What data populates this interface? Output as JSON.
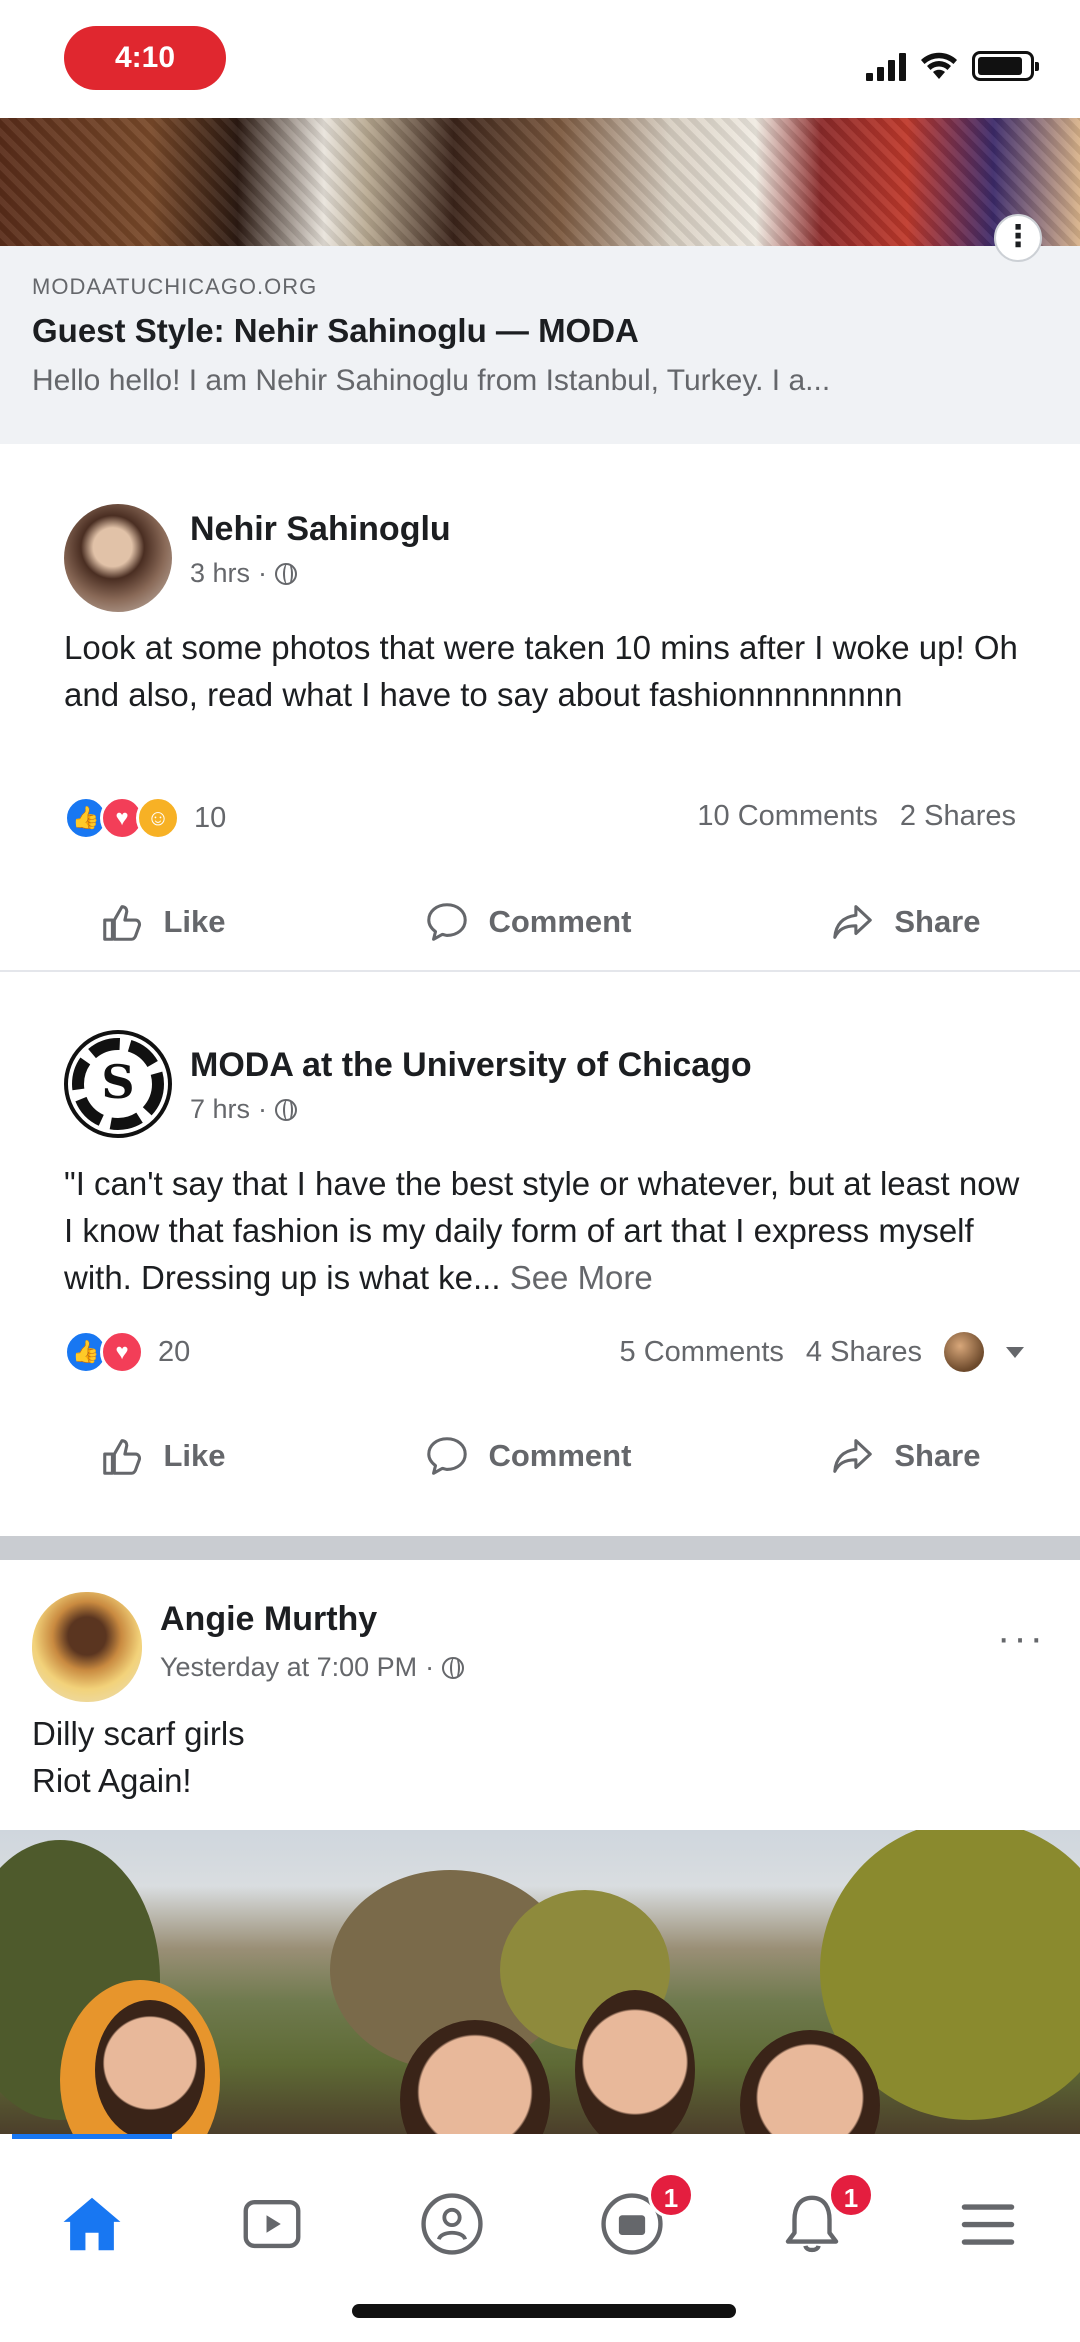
{
  "status_bar": {
    "time": "4:10"
  },
  "link_preview": {
    "domain": "MODAATUCHICAGO.ORG",
    "title": "Guest Style: Nehir Sahinoglu — MODA",
    "description": "Hello hello! I am Nehir Sahinoglu from Istanbul, Turkey. I a..."
  },
  "posts": [
    {
      "author": "Nehir Sahinoglu",
      "time": "3 hrs",
      "text": "Look at some photos that were taken 10 mins after I woke up! Oh and also, read what I have to say about fashionnnnnnnnn",
      "reaction_count": "10",
      "comments": "10 Comments",
      "shares": "2 Shares",
      "actions": {
        "like": "Like",
        "comment": "Comment",
        "share": "Share"
      }
    },
    {
      "author": "MODA at the University of Chicago",
      "time": "7 hrs",
      "text": "\"I can't say that I have the best style or whatever, but at least now I know that fashion is my daily form of art that I express myself with. Dressing up is what ke...",
      "see_more": "See More",
      "reaction_count": "20",
      "comments": "5 Comments",
      "shares": "4 Shares",
      "actions": {
        "like": "Like",
        "comment": "Comment",
        "share": "Share"
      }
    }
  ],
  "feed_post": {
    "author": "Angie Murthy",
    "time": "Yesterday at 7:00 PM",
    "text_line1": "Dilly scarf girls",
    "text_line2": "Riot Again!"
  },
  "bottom_nav": {
    "items": [
      "home-icon",
      "watch-icon",
      "groups-icon",
      "marketplace-icon",
      "notifications-icon",
      "menu-icon"
    ],
    "badges": {
      "marketplace": "1",
      "notifications": "1"
    },
    "accent": "#1877f2"
  }
}
